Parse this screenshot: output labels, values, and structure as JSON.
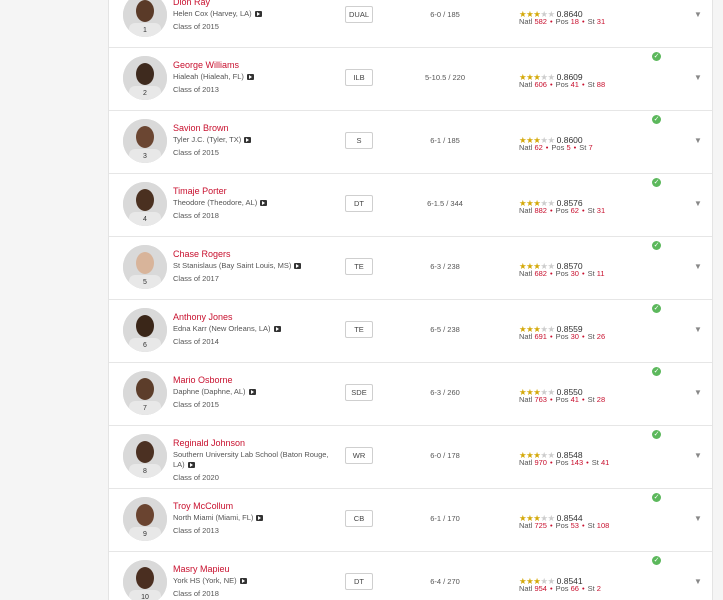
{
  "players": [
    {
      "name": "Dion Ray",
      "school": "Helen Cox (Harvey, LA)",
      "class": "Class of 2015",
      "pos": "DUAL",
      "size": "6-0 / 185",
      "stars": 3,
      "score": "0.8640",
      "natl": "582",
      "pos_rank": "18",
      "st": "31",
      "jersey": "1"
    },
    {
      "name": "George Williams",
      "school": "Hialeah (Hialeah, FL)",
      "class": "Class of 2013",
      "pos": "ILB",
      "size": "5-10.5 / 220",
      "stars": 3,
      "score": "0.8609",
      "natl": "606",
      "pos_rank": "41",
      "st": "88",
      "jersey": "2"
    },
    {
      "name": "Savion Brown",
      "school": "Tyler J.C. (Tyler, TX)",
      "class": "Class of 2015",
      "pos": "S",
      "size": "6-1 / 185",
      "stars": 3,
      "score": "0.8600",
      "natl": "62",
      "pos_rank": "5",
      "st": "7",
      "jersey": "3"
    },
    {
      "name": "Timaje Porter",
      "school": "Theodore (Theodore, AL)",
      "class": "Class of 2018",
      "pos": "DT",
      "size": "6-1.5 / 344",
      "stars": 3,
      "score": "0.8576",
      "natl": "882",
      "pos_rank": "62",
      "st": "31",
      "jersey": "4"
    },
    {
      "name": "Chase Rogers",
      "school": "St Stanislaus (Bay Saint Louis, MS)",
      "class": "Class of 2017",
      "pos": "TE",
      "size": "6-3 / 238",
      "stars": 3,
      "score": "0.8570",
      "natl": "682",
      "pos_rank": "30",
      "st": "11",
      "jersey": "5"
    },
    {
      "name": "Anthony Jones",
      "school": "Edna Karr (New Orleans, LA)",
      "class": "Class of 2014",
      "pos": "TE",
      "size": "6-5 / 238",
      "stars": 3,
      "score": "0.8559",
      "natl": "691",
      "pos_rank": "30",
      "st": "26",
      "jersey": "6"
    },
    {
      "name": "Mario Osborne",
      "school": "Daphne (Daphne, AL)",
      "class": "Class of 2015",
      "pos": "SDE",
      "size": "6-3 / 260",
      "stars": 3,
      "score": "0.8550",
      "natl": "763",
      "pos_rank": "41",
      "st": "28",
      "jersey": "7"
    },
    {
      "name": "Reginald Johnson",
      "school": "Southern University Lab School (Baton Rouge, LA)",
      "class": "Class of 2020",
      "pos": "WR",
      "size": "6-0 / 178",
      "stars": 3,
      "score": "0.8548",
      "natl": "970",
      "pos_rank": "143",
      "st": "41",
      "jersey": "8"
    },
    {
      "name": "Troy McCollum",
      "school": "North Miami (Miami, FL)",
      "class": "Class of 2013",
      "pos": "CB",
      "size": "6-1 / 170",
      "stars": 3,
      "score": "0.8544",
      "natl": "725",
      "pos_rank": "53",
      "st": "108",
      "jersey": "9"
    },
    {
      "name": "Masry Mapieu",
      "school": "York HS (York, NE)",
      "class": "Class of 2018",
      "pos": "DT",
      "size": "6-4 / 270",
      "stars": 3,
      "score": "0.8541",
      "natl": "954",
      "pos_rank": "66",
      "st": "2",
      "jersey": "10"
    }
  ],
  "labels": {
    "natl": "Natl",
    "pos": "Pos",
    "st": "St"
  },
  "colors": {
    "accent": "#c8102e",
    "star": "#d4a90a",
    "check": "#5cb85c"
  },
  "icons": {
    "video": "video-icon",
    "verified": "check-circle-icon",
    "expand": "chevron-down-icon"
  }
}
